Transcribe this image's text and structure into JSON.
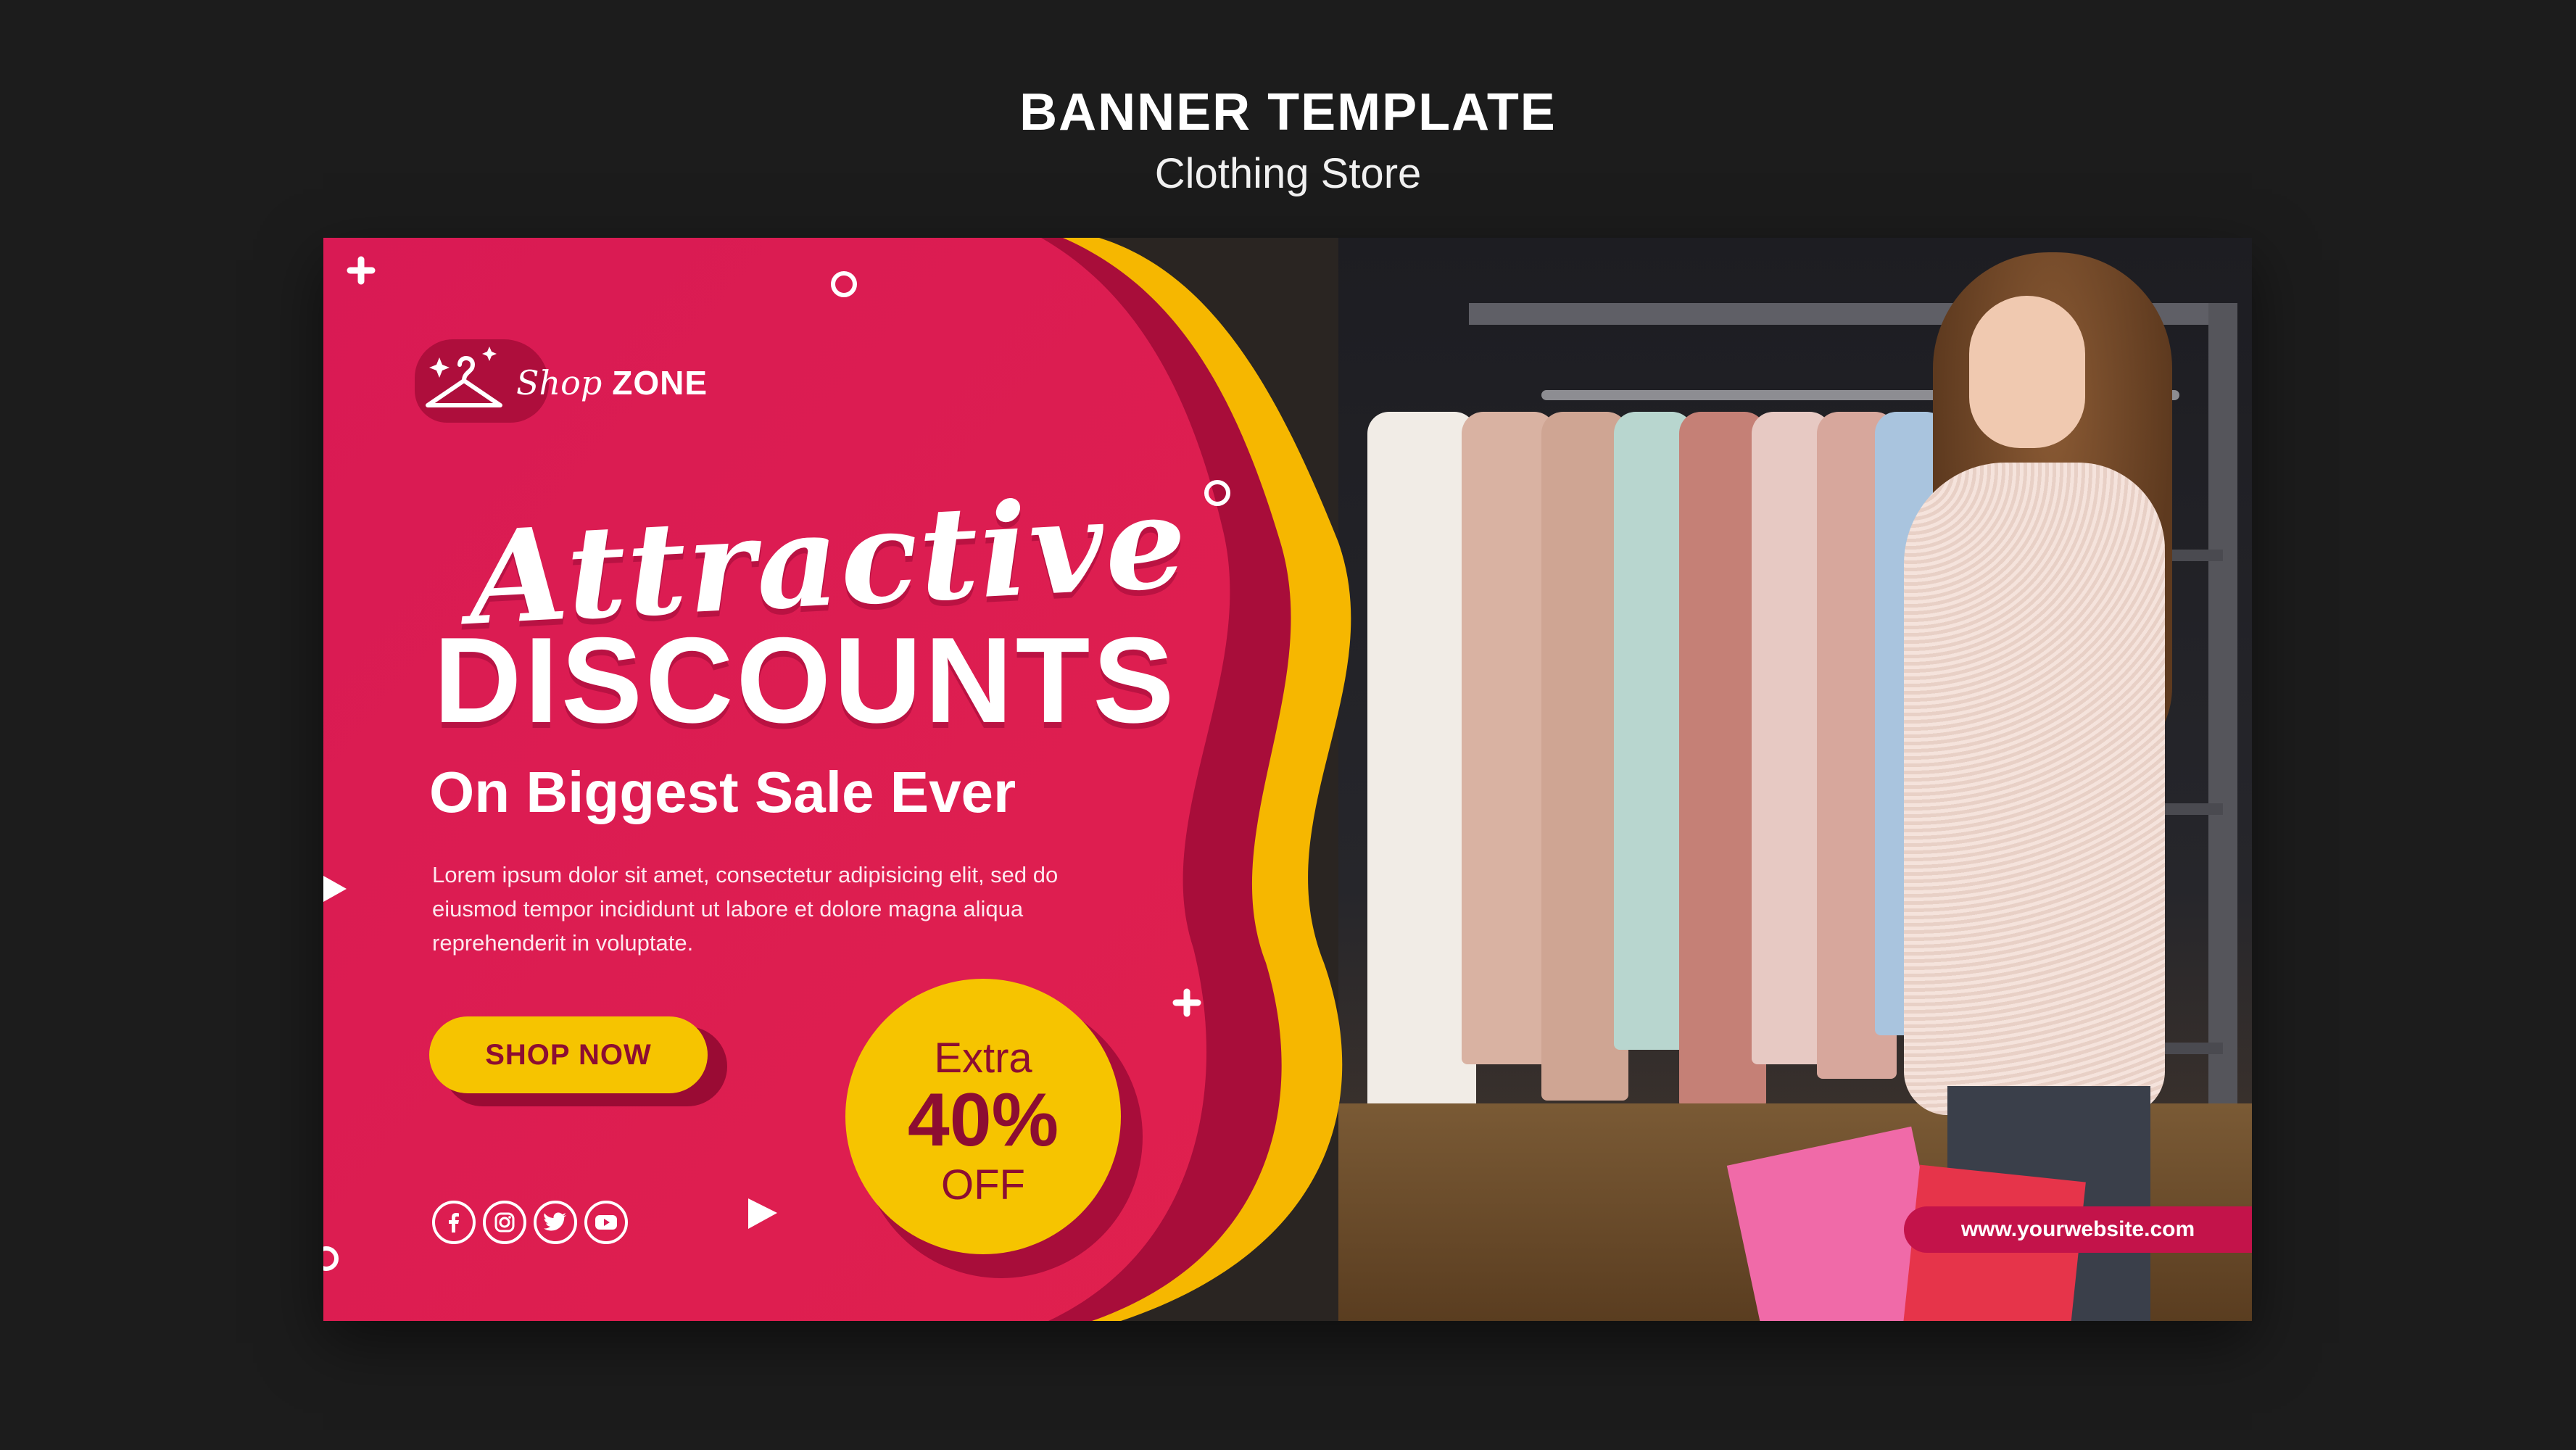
{
  "header": {
    "title": "BANNER TEMPLATE",
    "subtitle": "Clothing Store"
  },
  "banner": {
    "logo": {
      "script_text": "Shop",
      "bold_text": "ZONE",
      "icon": "hanger-icon"
    },
    "headline_script": "Attractive",
    "headline_bold": "DISCOUNTS",
    "tagline": "On Biggest Sale Ever",
    "body_text": "Lorem ipsum dolor sit amet, consectetur adipisicing elit, sed do eiusmod tempor incididunt ut labore et dolore magna aliqua reprehenderit in voluptate.",
    "cta_label": "SHOP NOW",
    "offer": {
      "extra": "Extra",
      "percent": "40%",
      "off": "OFF"
    },
    "social_icons": [
      "facebook-icon",
      "instagram-icon",
      "twitter-icon",
      "youtube-icon"
    ],
    "website": "www.yourwebsite.com"
  },
  "colors": {
    "background": "#1c1c1c",
    "brand_pink": "#dc1f53",
    "dark_pink": "#a80d3a",
    "accent_yellow": "#f6c400",
    "text_on_yellow": "#8c0d32"
  }
}
